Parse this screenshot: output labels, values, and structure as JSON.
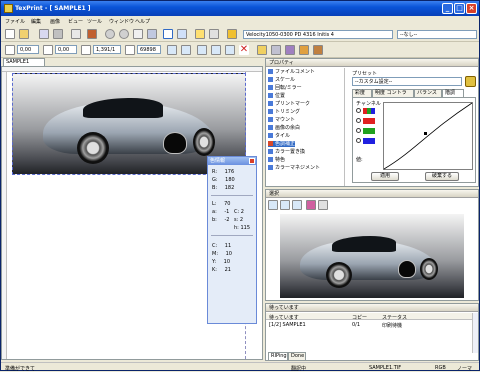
{
  "window": {
    "title": "TexPrint - [ SAMPLE1 ]"
  },
  "menu": [
    "ファイル",
    "編集",
    "画像",
    "ビュー",
    "ツール",
    "ウィンドウ",
    "ヘルプ"
  ],
  "toolbar": {
    "printer_value": "Velocity1050-0300 PD 4316 Initis 4",
    "preset_value": "--なし--",
    "x_value": "0,00",
    "y_value": "0,00",
    "zoom_value": "1,391/1",
    "scale_value": "69898"
  },
  "document_tab": {
    "label": "SAMPLE1"
  },
  "info_panel": {
    "title": "色情報",
    "rows": [
      {
        "label": "R:",
        "value": "176"
      },
      {
        "label": "G:",
        "value": "180"
      },
      {
        "label": "B:",
        "value": "182"
      },
      {
        "label": "L:",
        "value": "70"
      },
      {
        "label": "a:",
        "value": "-1"
      },
      {
        "label": "b:",
        "value": "-2"
      },
      {
        "label": "C:",
        "value": "11"
      },
      {
        "label": "M:",
        "value": "10"
      },
      {
        "label": "Y:",
        "value": "10"
      },
      {
        "label": "K:",
        "value": "21"
      }
    ],
    "extra": [
      {
        "label": "C:",
        "value": "2"
      },
      {
        "label": "s:",
        "value": "2"
      },
      {
        "label": "h:",
        "value": "115"
      }
    ]
  },
  "properties": {
    "title": "プロパティ",
    "tree": [
      {
        "label": "ファイルコメント",
        "color": "#4a7ad8"
      },
      {
        "label": "スケール",
        "color": "#4a7ad8"
      },
      {
        "label": "回転/ミラー",
        "color": "#4a7ad8"
      },
      {
        "label": "位置",
        "color": "#4a7ad8"
      },
      {
        "label": "プリントマーク",
        "color": "#4a7ad8"
      },
      {
        "label": "トリミング",
        "color": "#4a7ad8"
      },
      {
        "label": "マウント",
        "color": "#4a7ad8"
      },
      {
        "label": "画像の余白",
        "color": "#4a7ad8"
      },
      {
        "label": "タイル",
        "color": "#4a7ad8"
      },
      {
        "label": "色調補正",
        "color": "#d84a2a"
      },
      {
        "label": "カラー置き換",
        "color": "#4a7ad8"
      },
      {
        "label": "特色",
        "color": "#4a7ad8"
      },
      {
        "label": "カラーマネジメント",
        "color": "#4a7ad8"
      }
    ],
    "preset_label": "プリセット",
    "preset_value": "--カスタム設定--",
    "tabs": [
      "彩度",
      "明度 コントラスト",
      "バランス",
      "階調"
    ],
    "channel_label": "チャンネル",
    "channel_checked": "一",
    "value_label": "値:",
    "apply_label": "適用",
    "reset_label": "破棄する"
  },
  "selection_panel": {
    "title": "選択"
  },
  "queue_panel": {
    "title": "待っています",
    "columns": [
      "待っています",
      "コピー",
      "ステータス"
    ],
    "rows": [
      {
        "name": "[1/2] SAMPLE1",
        "copies": "0/1",
        "status": "印刷待機"
      }
    ],
    "tabs": [
      "RIPing",
      "Done"
    ]
  },
  "statusbar": {
    "left": "準備ができて",
    "center": "翻訳中",
    "file": "SAMPLE1.TIF",
    "mode": "RGB",
    "zoom": "ノーマ"
  },
  "colors": {
    "titlebar": "#0a54d8",
    "accent": "#316ac5"
  }
}
